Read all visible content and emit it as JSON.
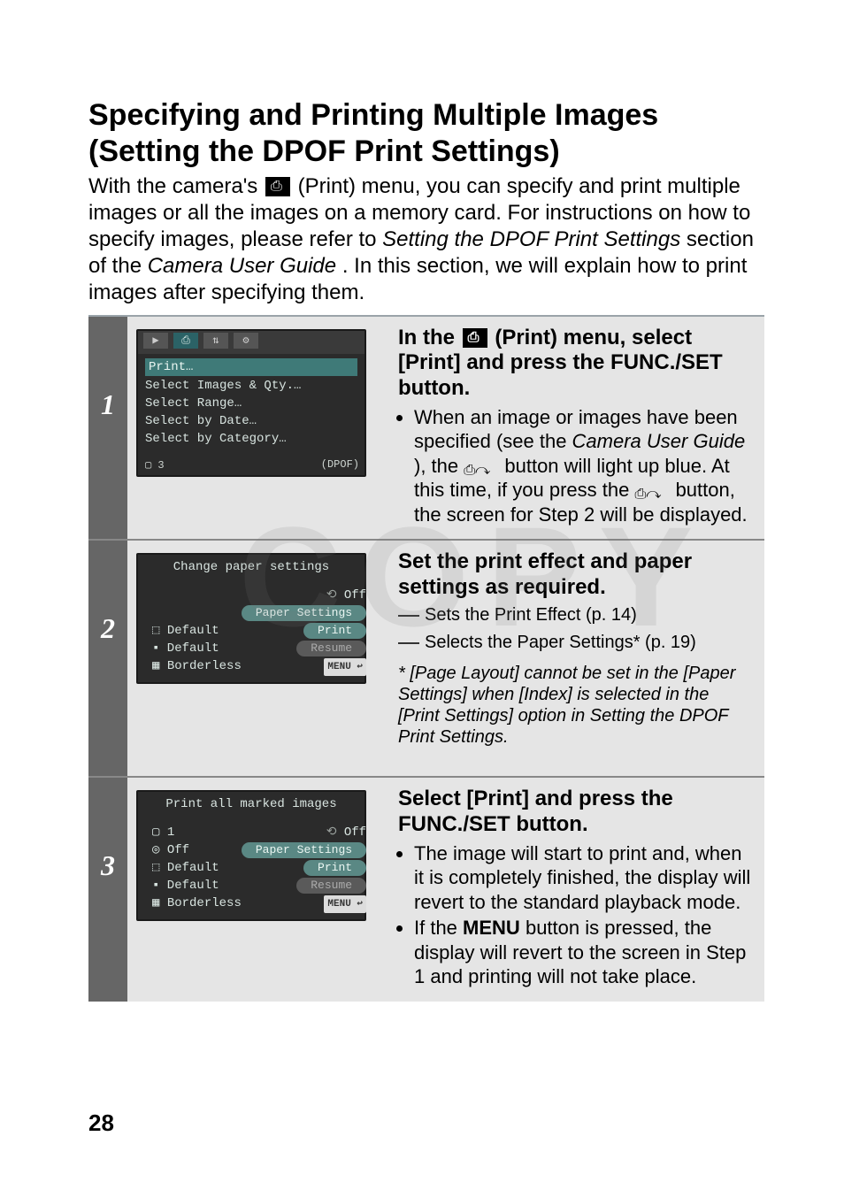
{
  "page_number": "28",
  "title": "Specifying and Printing Multiple Images (Setting the DPOF Print Settings)",
  "intro_pre": "With the camera's ",
  "intro_mid": "(Print) menu, you can specify and print multiple images or all the images on a memory card. For instructions on how to specify images, please refer to ",
  "intro_ital1": "Setting the DPOF Print Settings",
  "intro_mid2": " section of the ",
  "intro_ital2": "Camera User Guide",
  "intro_post": ". In this section, we will explain how to print images after specifying them.",
  "watermark": "COPY",
  "steps": [
    {
      "num": "1",
      "screen": {
        "type": "menu",
        "tab_icons": [
          "▶",
          "⎙",
          "⇅",
          "⚙"
        ],
        "items": [
          "Print…",
          "Select Images & Qty.…",
          "Select Range…",
          "Select by Date…",
          "Select by Category…"
        ],
        "footer_left": "▢ 3",
        "footer_right": "(DPOF)"
      },
      "heading_pre": "In the ",
      "heading_post": " (Print) menu, select [Print] and press the FUNC./SET button.",
      "bullet_pre": "When an image or images have been specified (see the ",
      "bullet_ital": "Camera User Guide",
      "bullet_mid": "), the ",
      "bullet_mid2": " button will light up blue. At this time, if you press the ",
      "bullet_post": " button, the screen for Step 2 will be displayed."
    },
    {
      "num": "2",
      "screen": {
        "titlebar": "Change paper settings",
        "left": [
          "",
          "",
          "⬚ Default",
          "▪ Default",
          "▦ Borderless"
        ],
        "right_label_off": "Off",
        "right_paper": "Paper Settings",
        "right_print": "Print",
        "right_resume": "Resume",
        "right_menu": "MENU ↩"
      },
      "heading": "Set the print effect and paper settings as required.",
      "annot1": "Sets the Print Effect (p. 14)",
      "annot2": "Selects the Paper Settings* (p. 19)",
      "footnote": "* [Page Layout] cannot be set in the [Paper Settings] when [Index] is selected in the [Print Settings] option in Setting the DPOF Print Settings."
    },
    {
      "num": "3",
      "screen": {
        "titlebar": "Print all marked images",
        "left": [
          "▢ 1",
          "◎ Off",
          "⬚ Default",
          "▪ Default",
          "▦ Borderless"
        ],
        "right_label_off": "Off",
        "right_paper": "Paper Settings",
        "right_print": "Print",
        "right_resume": "Resume",
        "right_menu": "MENU ↩"
      },
      "heading": "Select [Print] and press the FUNC./SET button.",
      "bullet1": "The image will start to print and, when it is completely finished, the display will revert to the standard playback mode.",
      "bullet2_pre": "If the ",
      "bullet2_bold": "MENU",
      "bullet2_post": " button is pressed, the display will revert to the screen in Step 1 and printing will not take place."
    }
  ]
}
